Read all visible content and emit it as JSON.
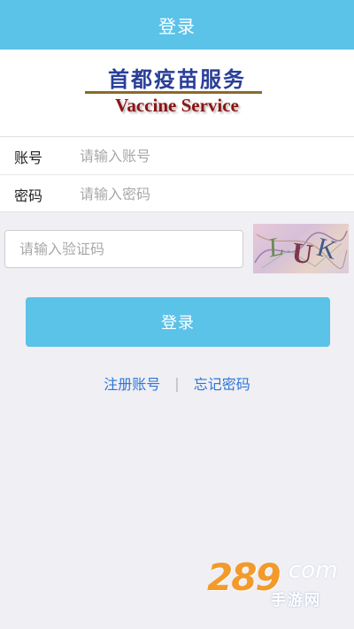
{
  "header": {
    "title": "登录"
  },
  "logo": {
    "title_cn": "首都疫苗服务",
    "title_en": "Vaccine Service"
  },
  "form": {
    "account": {
      "label": "账号",
      "placeholder": "请输入账号",
      "value": ""
    },
    "password": {
      "label": "密码",
      "placeholder": "请输入密码",
      "value": ""
    },
    "captcha": {
      "placeholder": "请输入验证码",
      "value": "",
      "image_text": "LUK"
    }
  },
  "actions": {
    "login_label": "登录",
    "register_label": "注册账号",
    "separator": "|",
    "forgot_label": "忘记密码"
  },
  "watermark": {
    "number": "289",
    "suffix": "com",
    "subtitle": "手游网"
  },
  "colors": {
    "primary": "#5bc2e8",
    "page_background": "#efeff4",
    "link": "#2f76d6",
    "logo_cn": "#2a3f9a",
    "logo_en": "#8c1414"
  }
}
